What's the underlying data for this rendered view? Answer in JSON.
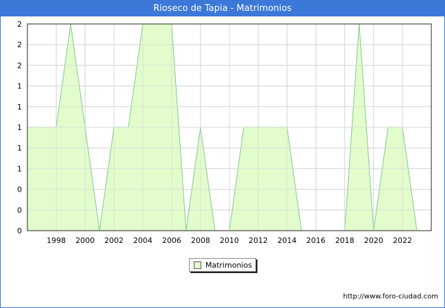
{
  "header": {
    "title": "Rioseco de Tapia - Matrimonios"
  },
  "legend": {
    "label": "Matrimonios"
  },
  "footer": {
    "source": "http://www.foro-ciudad.com"
  },
  "colors": {
    "title_bar": "#3b78d8",
    "area_fill": "#e2fccb",
    "area_line": "#7ecb8f",
    "grid": "#d8d8d8"
  },
  "chart_data": {
    "type": "area",
    "title": "Rioseco de Tapia - Matrimonios",
    "xlabel": "",
    "ylabel": "",
    "x": [
      1996,
      1997,
      1998,
      1999,
      2000,
      2001,
      2002,
      2003,
      2004,
      2005,
      2006,
      2007,
      2008,
      2009,
      2010,
      2011,
      2012,
      2013,
      2014,
      2015,
      2016,
      2017,
      2018,
      2019,
      2020,
      2021,
      2022,
      2023
    ],
    "series": [
      {
        "name": "Matrimonios",
        "values": [
          1,
          1,
          1,
          2,
          1,
          0,
          1,
          1,
          2,
          2,
          2,
          0,
          1,
          0,
          0,
          1,
          1,
          1,
          1,
          0,
          0,
          0,
          0,
          2,
          0,
          1,
          1,
          0
        ]
      }
    ],
    "xlim": [
      1996,
      2024
    ],
    "ylim": [
      0,
      2
    ],
    "x_ticks": [
      1998,
      2000,
      2002,
      2004,
      2006,
      2008,
      2010,
      2012,
      2014,
      2016,
      2018,
      2020,
      2022
    ],
    "y_tick_labels": [
      "0",
      "0",
      "0",
      "1",
      "1",
      "1",
      "1",
      "1",
      "2",
      "2",
      "2"
    ],
    "grid": true,
    "legend_position": "bottom-center"
  }
}
